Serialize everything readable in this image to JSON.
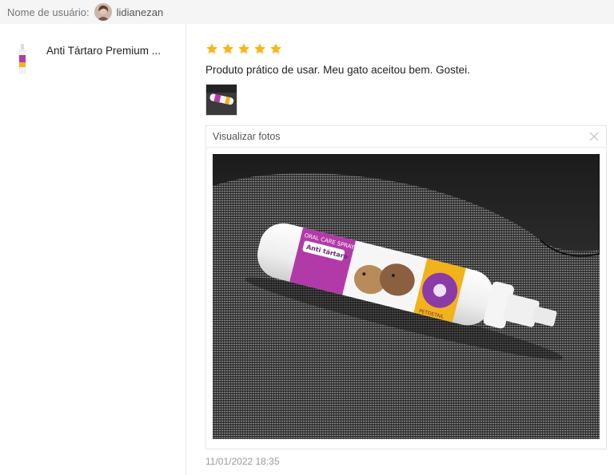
{
  "header": {
    "username_label": "Nome de usuário:",
    "username": "lidianezan"
  },
  "product": {
    "name": "Anti Tártaro Premium ..."
  },
  "review": {
    "rating": 5,
    "comment": "Produto prático de usar. Meu gato aceitou bem. Gostei.",
    "timestamp": "11/01/2022 18:35"
  },
  "viewer": {
    "title": "Visualizar fotos",
    "photo": {
      "label_top": "ORAL CARE SPRAY",
      "label_product": "Anti tártaro",
      "brand": "PETDETAIL"
    }
  },
  "colors": {
    "star": "#f6b81a",
    "label_purple": "#b23aa8",
    "label_yellow": "#f2b21a"
  }
}
